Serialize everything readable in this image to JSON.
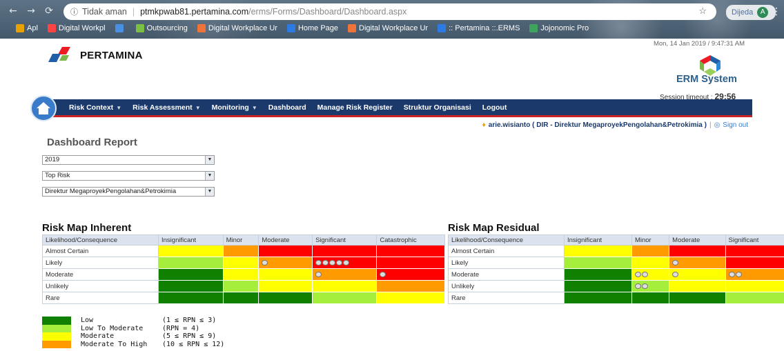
{
  "browser": {
    "security": "Tidak aman",
    "host": "ptmkpwab81.pertamina.com",
    "path": "/erms/Forms/Dashboard/Dashboard.aspx",
    "profile": "Dijeda",
    "profile_initial": "A",
    "bookmarks": [
      {
        "label": "Apl",
        "icon_color": "#e8a200"
      },
      {
        "label": "Digital Workpl",
        "icon_color": "#f44"
      },
      {
        "label": "",
        "icon_color": "#4a90e2"
      },
      {
        "label": "Outsourcing",
        "icon_color": "#7bc043"
      },
      {
        "label": "Digital Workplace Ur",
        "icon_color": "#f0743a"
      },
      {
        "label": "Home Page",
        "icon_color": "#2c7be5"
      },
      {
        "label": "Digital Workplace Ur",
        "icon_color": "#f0743a"
      },
      {
        "label": ":: Pertamina ::.ERMS",
        "icon_color": "#2c7be5"
      },
      {
        "label": "Jojonomic Pro",
        "icon_color": "#3da35d"
      }
    ]
  },
  "app": {
    "brand": "PERTAMINA",
    "datetime": "Mon, 14 Jan 2019 / 9:47:31 AM",
    "erm_title": "ERM System",
    "session_label": "Session timeout : ",
    "session_value": "29:56",
    "menu": [
      "Risk Context",
      "Risk Assessment",
      "Monitoring",
      "Dashboard",
      "Manage Risk Register",
      "Struktur Organisasi",
      "Logout"
    ],
    "user": "arie.wisianto ( DIR - Direktur MegaproyekPengolahan&Petrokimia )",
    "signout": "Sign out"
  },
  "dashboard": {
    "title": "Dashboard Report",
    "filters": {
      "year": "2019",
      "type": "Top Risk",
      "unit": "Direktur MegaproyekPengolahan&Petrokimia"
    }
  },
  "colors": {
    "g": "#108000",
    "lg": "#a6ee3c",
    "y": "#ffff00",
    "o": "#ff9a00",
    "r": "#ff0000"
  },
  "inherent": {
    "title": "Risk Map Inherent",
    "corner": "Likelihood/Consequence",
    "cols": [
      "Insignificant",
      "Minor",
      "Moderate",
      "Significant",
      "Catastrophic"
    ],
    "rows": [
      {
        "label": "Almost Certain",
        "cells": [
          "y",
          "o",
          "r",
          "r",
          "r"
        ],
        "marks": [
          0,
          0,
          0,
          0,
          0
        ]
      },
      {
        "label": "Likely",
        "cells": [
          "lg",
          "y",
          "o",
          "r",
          "r"
        ],
        "marks": [
          0,
          0,
          1,
          5,
          0
        ]
      },
      {
        "label": "Moderate",
        "cells": [
          "g",
          "y",
          "y",
          "o",
          "r"
        ],
        "marks": [
          0,
          0,
          0,
          1,
          1
        ]
      },
      {
        "label": "Unlikely",
        "cells": [
          "g",
          "lg",
          "y",
          "y",
          "o"
        ],
        "marks": [
          0,
          0,
          0,
          0,
          0
        ]
      },
      {
        "label": "Rare",
        "cells": [
          "g",
          "g",
          "g",
          "lg",
          "y"
        ],
        "marks": [
          0,
          0,
          0,
          0,
          0
        ]
      }
    ]
  },
  "residual": {
    "title": "Risk Map Residual",
    "corner": "Likelihood/Consequence",
    "cols": [
      "Insignificant",
      "Minor",
      "Moderate",
      "Significant"
    ],
    "rows": [
      {
        "label": "Almost Certain",
        "cells": [
          "y",
          "o",
          "r",
          "r"
        ],
        "marks": [
          0,
          0,
          0,
          0
        ]
      },
      {
        "label": "Likely",
        "cells": [
          "lg",
          "y",
          "o",
          "r"
        ],
        "marks": [
          0,
          0,
          1,
          0
        ]
      },
      {
        "label": "Moderate",
        "cells": [
          "g",
          "y",
          "y",
          "o"
        ],
        "marks": [
          0,
          2,
          1,
          2
        ]
      },
      {
        "label": "Unlikely",
        "cells": [
          "g",
          "lg",
          "y",
          "y"
        ],
        "marks": [
          0,
          2,
          0,
          0
        ]
      },
      {
        "label": "Rare",
        "cells": [
          "g",
          "g",
          "g",
          "lg"
        ],
        "marks": [
          0,
          0,
          0,
          0
        ]
      }
    ]
  },
  "legend": [
    {
      "color": "#108000",
      "label": "Low",
      "range": "(1 ≤ RPN ≤ 3)"
    },
    {
      "color": "#a6ee3c",
      "label": "Low To Moderate",
      "range": "(RPN = 4)"
    },
    {
      "color": "#ffff00",
      "label": "Moderate",
      "range": "(5 ≤ RPN ≤ 9)"
    },
    {
      "color": "#ff9a00",
      "label": "Moderate To High",
      "range": "(10 ≤ RPN ≤ 12)"
    }
  ]
}
